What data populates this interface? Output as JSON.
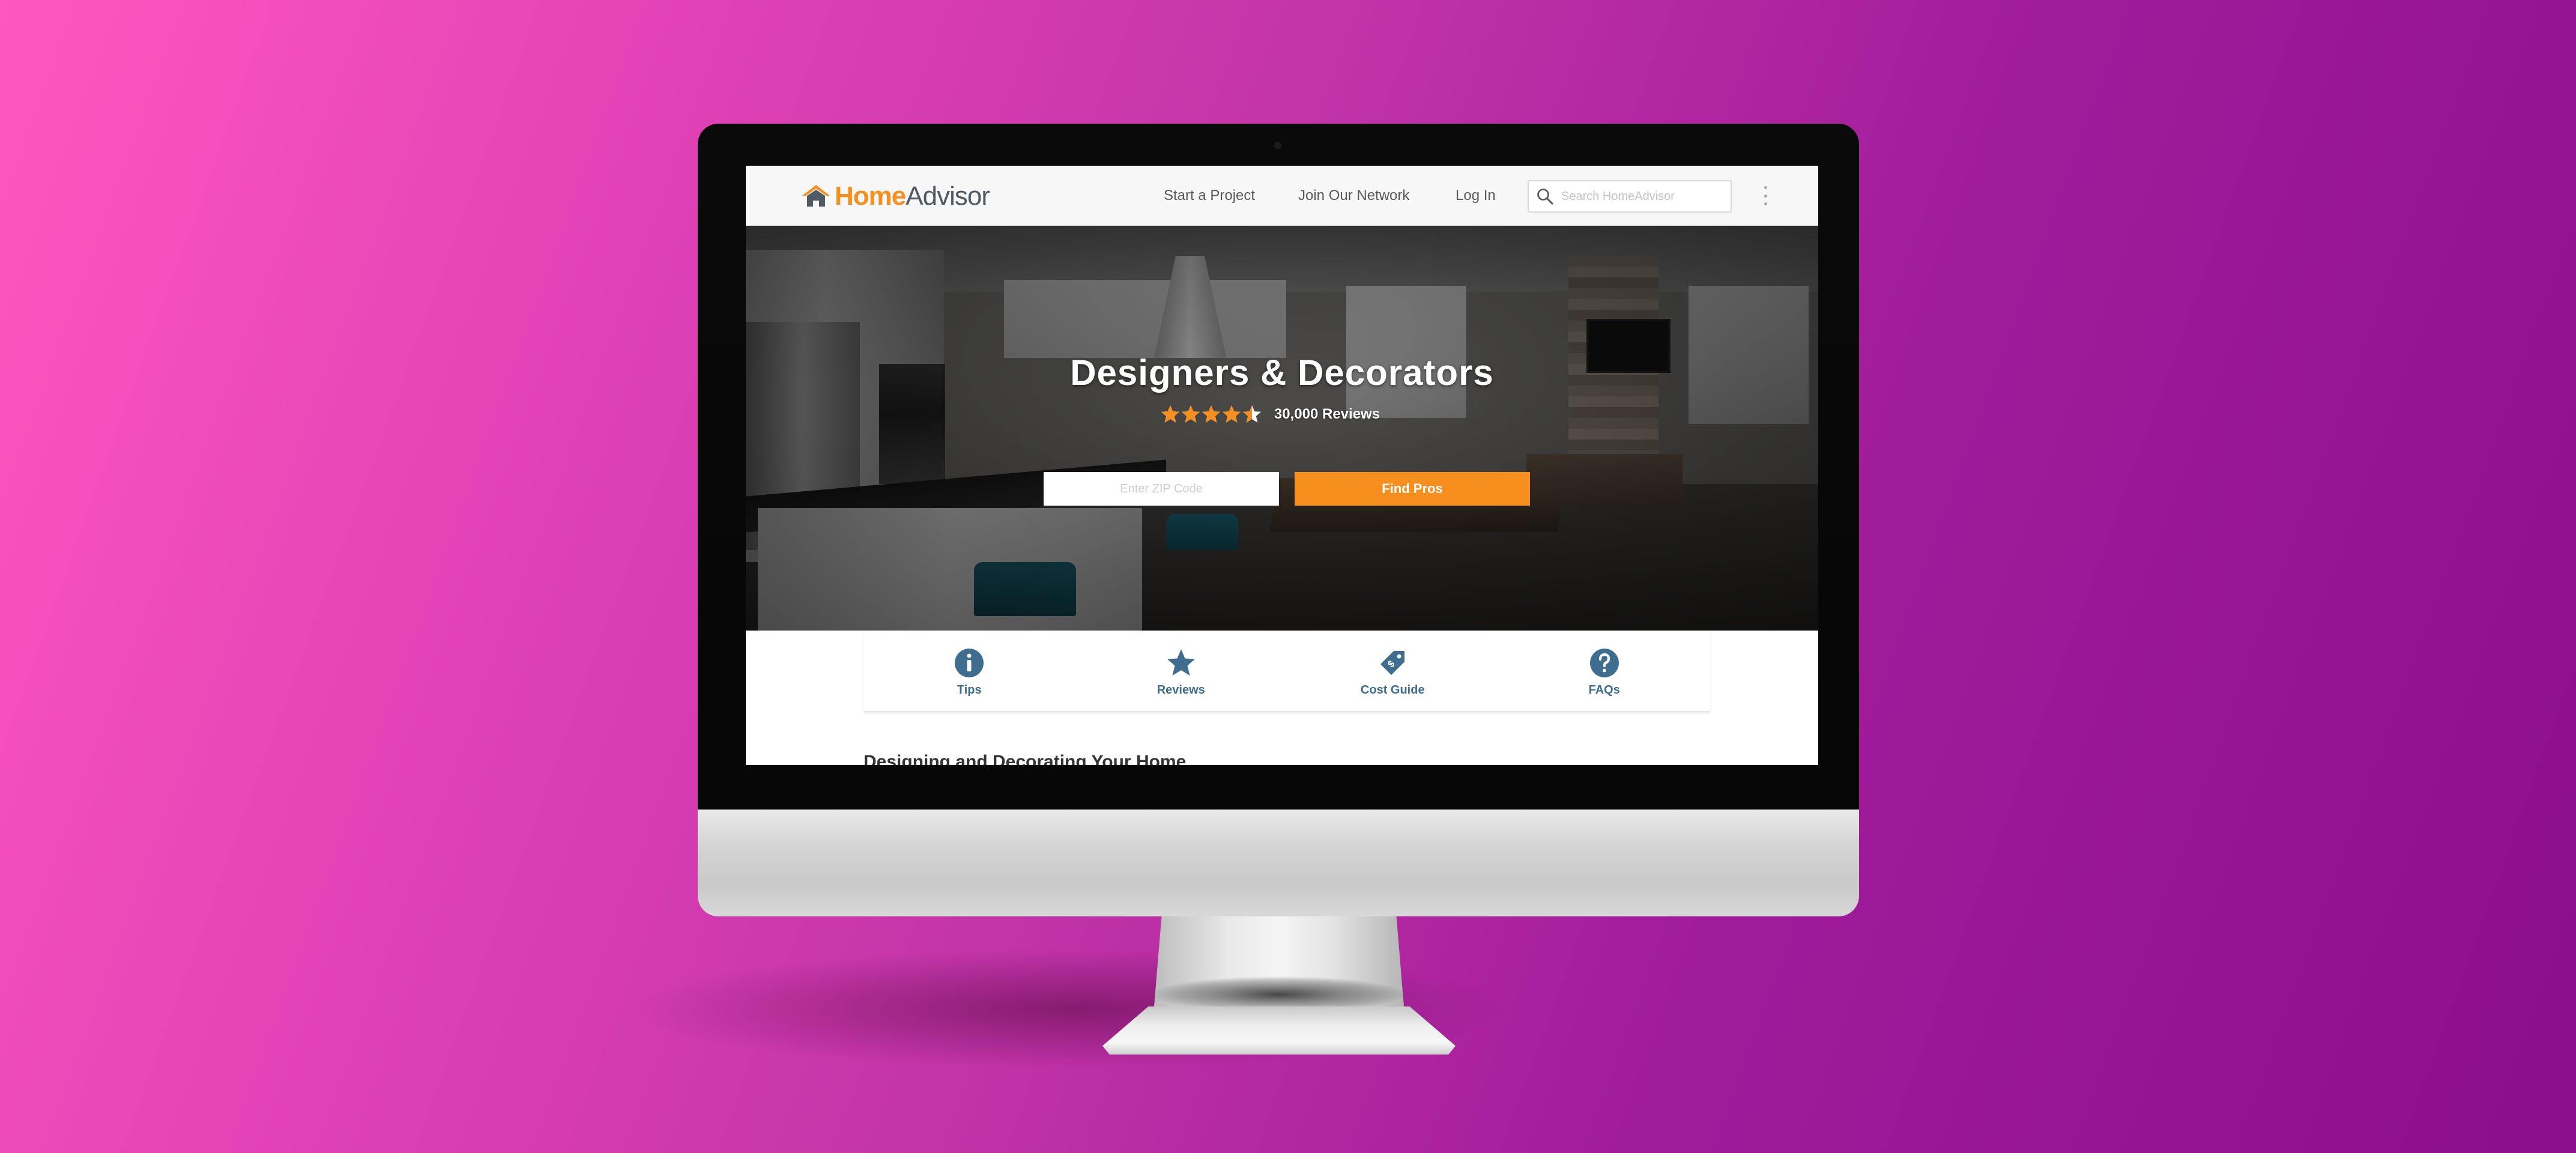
{
  "header": {
    "logo_home": "Home",
    "logo_advisor": "Advisor",
    "nav": {
      "start_project": "Start a Project",
      "join_network": "Join Our Network",
      "log_in": "Log In"
    },
    "search_placeholder": "Search HomeAdvisor"
  },
  "hero": {
    "title": "Designers & Decorators",
    "rating": 4.5,
    "reviews_count": "30,000 Reviews",
    "zip_placeholder": "Enter ZIP Code",
    "find_button": "Find Pros"
  },
  "quick_tabs": [
    {
      "label": "Tips",
      "icon": "info-icon"
    },
    {
      "label": "Reviews",
      "icon": "star-icon"
    },
    {
      "label": "Cost Guide",
      "icon": "price-tag-icon"
    },
    {
      "label": "FAQs",
      "icon": "question-icon"
    }
  ],
  "content": {
    "heading": "Designing and Decorating Your Home"
  },
  "colors": {
    "brand_orange": "#f68f1e",
    "brand_blue": "#3e6d8f",
    "logo_gray": "#505a64"
  }
}
